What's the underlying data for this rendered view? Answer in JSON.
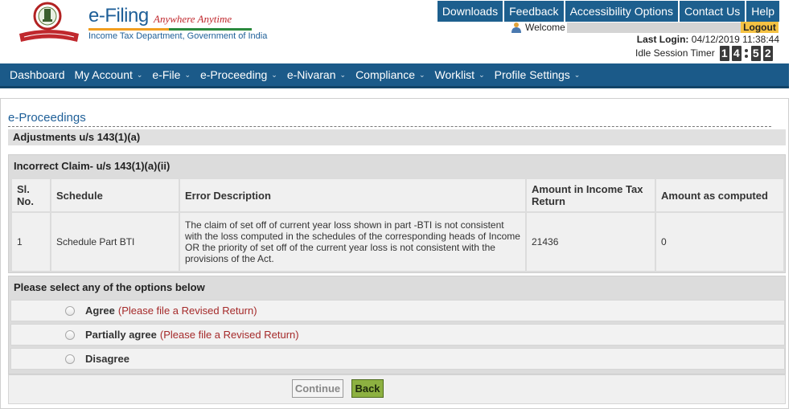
{
  "header": {
    "brand_title": "e-Filing",
    "brand_tagline": "Anywhere Anytime",
    "brand_department": "Income Tax Department, Government of India",
    "logo_icon": "income-tax-department-emblem",
    "top_links": [
      "Downloads",
      "Feedback",
      "Accessibility Options",
      "Contact Us",
      "Help"
    ],
    "welcome_label": "Welcome",
    "logout_label": "Logout",
    "last_login_label": "Last Login:",
    "last_login_value": "04/12/2019 11:38:44",
    "idle_timer_label": "Idle Session Timer",
    "idle_timer_digits": [
      "1",
      "4",
      "5",
      "2"
    ],
    "colors": {
      "top_link_bg": "#1d5f8e",
      "logout_bg": "#f5c243",
      "brand_blue": "#1e5f98",
      "tagline_red": "#c0282d"
    }
  },
  "nav": {
    "items": [
      {
        "label": "Dashboard",
        "has_dropdown": false
      },
      {
        "label": "My Account",
        "has_dropdown": true
      },
      {
        "label": "e-File",
        "has_dropdown": true
      },
      {
        "label": "e-Proceeding",
        "has_dropdown": true
      },
      {
        "label": "e-Nivaran",
        "has_dropdown": true
      },
      {
        "label": "Compliance",
        "has_dropdown": true
      },
      {
        "label": "Worklist",
        "has_dropdown": true
      },
      {
        "label": "Profile Settings",
        "has_dropdown": true
      }
    ],
    "caret": "⌄",
    "bg_color": "#1b5a89"
  },
  "page": {
    "heading": "e-Proceedings",
    "section_title": "Adjustments u/s 143(1)(a)",
    "claim_title": "Incorrect Claim- u/s 143(1)(a)(ii)",
    "table": {
      "headers": [
        "Sl. No.",
        "Schedule",
        "Error Description",
        "Amount in Income Tax Return",
        "Amount as computed"
      ],
      "rows": [
        {
          "sl_no": "1",
          "schedule": "Schedule Part BTI",
          "error_description": "The claim of set off of current year loss shown in part -BTI is not consistent with the loss computed in the schedules of the corresponding heads of Income OR the priority of set off of the current year loss is not consistent with the provisions of the Act.",
          "amount_itr": "21436",
          "amount_computed": "0"
        }
      ]
    },
    "options_title": "Please select any of the options below",
    "options": [
      {
        "label": "Agree",
        "note": "(Please file a Revised Return)"
      },
      {
        "label": "Partially agree",
        "note": "(Please file a Revised Return)"
      },
      {
        "label": "Disagree",
        "note": ""
      }
    ],
    "continue_label": "Continue",
    "back_label": "Back",
    "colors": {
      "back_button_bg": "#8db141",
      "note_red": "#a52a2a"
    }
  }
}
